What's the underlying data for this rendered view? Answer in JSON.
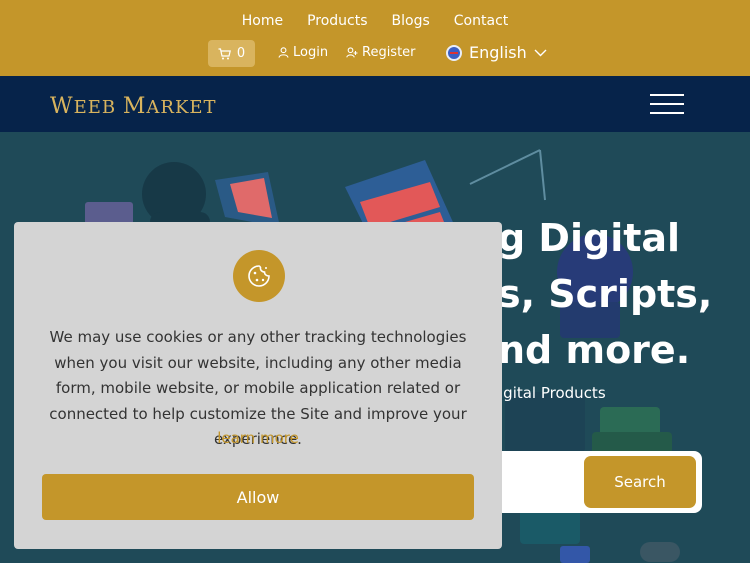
{
  "topnav": {
    "items": [
      {
        "label": "Home"
      },
      {
        "label": "Products"
      },
      {
        "label": "Blogs"
      },
      {
        "label": "Contact"
      }
    ]
  },
  "account": {
    "cart_count": "0",
    "login_label": "Login",
    "register_label": "Register",
    "language_label": "English"
  },
  "header": {
    "logo_w": "W",
    "logo_rest": "EEB",
    "logo_m": "M",
    "logo_rest2": "ARKET"
  },
  "hero": {
    "title_line1": "g Digital",
    "title_line2": "s, Scripts,",
    "title_line3": "nd more.",
    "subtitle": "igital Products",
    "search_button_label": "Search"
  },
  "cookie": {
    "text": "We may use cookies or any other tracking technologies when you visit our website, including any other media form, mobile website, or mobile application related or connected to help customize the Site and improve your experience.",
    "learn_more": "learn more",
    "allow_label": "Allow"
  },
  "colors": {
    "brand_gold": "#c4962a",
    "header_navy": "#06234a",
    "hero_teal": "#1f4a58"
  }
}
